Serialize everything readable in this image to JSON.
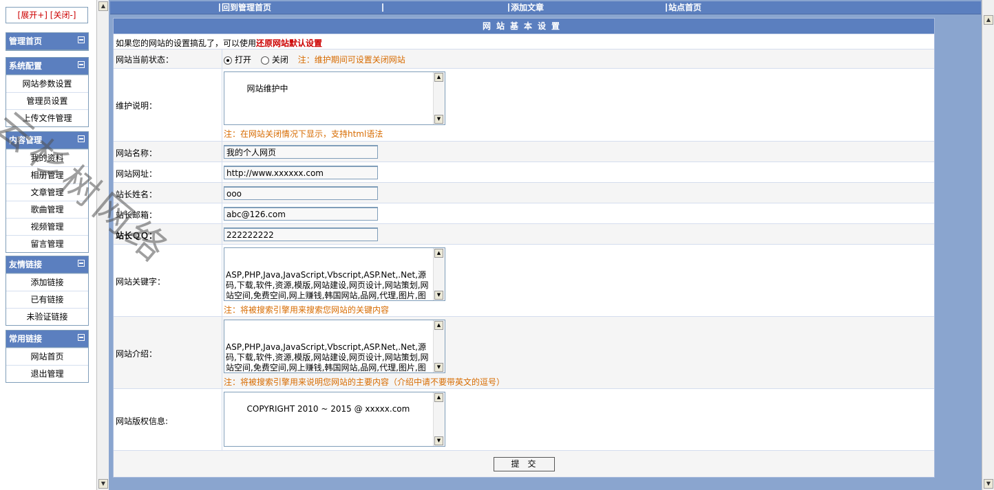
{
  "sidebar": {
    "expand": "[展开+]",
    "collapse": "[关闭-]",
    "groups": [
      {
        "title": "管理首页",
        "items": []
      },
      {
        "title": "系统配置",
        "items": [
          "网站参数设置",
          "管理员设置",
          "上传文件管理"
        ]
      },
      {
        "title": "内容管理",
        "items": [
          "我的资料",
          "相册管理",
          "文章管理",
          "歌曲管理",
          "视频管理",
          "留言管理"
        ]
      },
      {
        "title": "友情链接",
        "items": [
          "添加链接",
          "已有链接",
          "未验证链接"
        ]
      },
      {
        "title": "常用链接",
        "items": [
          "网站首页",
          "退出管理"
        ]
      }
    ]
  },
  "topnav": {
    "home": "回到管理首页",
    "add_article": "添加文章",
    "site_home": "站点首页"
  },
  "form": {
    "title": "网站基本设置",
    "intro_text": "如果您的网站的设置搞乱了，可以使用",
    "restore_link": "还原网站默认设置",
    "status_label": "网站当前状态：",
    "status_open": "打开",
    "status_close": "关闭",
    "status_note": "注：维护期间可设置关闭网站",
    "maint_label": "维护说明：",
    "maint_value": "网站维护中",
    "maint_note": "注：在网站关闭情况下显示，支持html语法",
    "name_label": "网站名称：",
    "name_value": "我的个人网页",
    "url_label": "网站网址：",
    "url_value": "http://www.xxxxxx.com",
    "owner_label": "站长姓名：",
    "owner_value": "ooo",
    "email_label": "站长邮箱：",
    "email_value": "abc@126.com",
    "qq_label": "站长ＱＱ：",
    "qq_value": "222222222",
    "kw_label": "网站关键字：",
    "kw_value": "ASP,PHP,Java,JavaScript,Vbscript,ASP.Net,.Net,源码,下载,软件,资源,模版,网站建设,网页设计,网站策划,网站空间,免费空间,网上赚钱,韩国网站,品网,代理,图片,图库,设计,CG,域名,虚拟主机,网站推广,艺术,破解",
    "kw_note": "注：将被搜索引擎用来搜索您网站的关键内容",
    "desc_label": "网站介绍：",
    "desc_value": "ASP,PHP,Java,JavaScript,Vbscript,ASP.Net,.Net,源码,下载,软件,资源,模版,网站建设,网页设计,网站策划,网站空间,免费空间,网上赚钱,韩国网站,品网,代理,图片,图库,设计,CG,域名,虚拟主机,网站推广,艺术,破解",
    "desc_note": "注：将被搜索引擎用来说明您网站的主要内容（介绍中请不要带英文的逗号）",
    "copy_label": "网站版权信息:",
    "copy_value": "COPYRIGHT 2010 ~ 2015 @ xxxxx.com",
    "submit": "提交"
  },
  "watermark": "云杉树网络"
}
